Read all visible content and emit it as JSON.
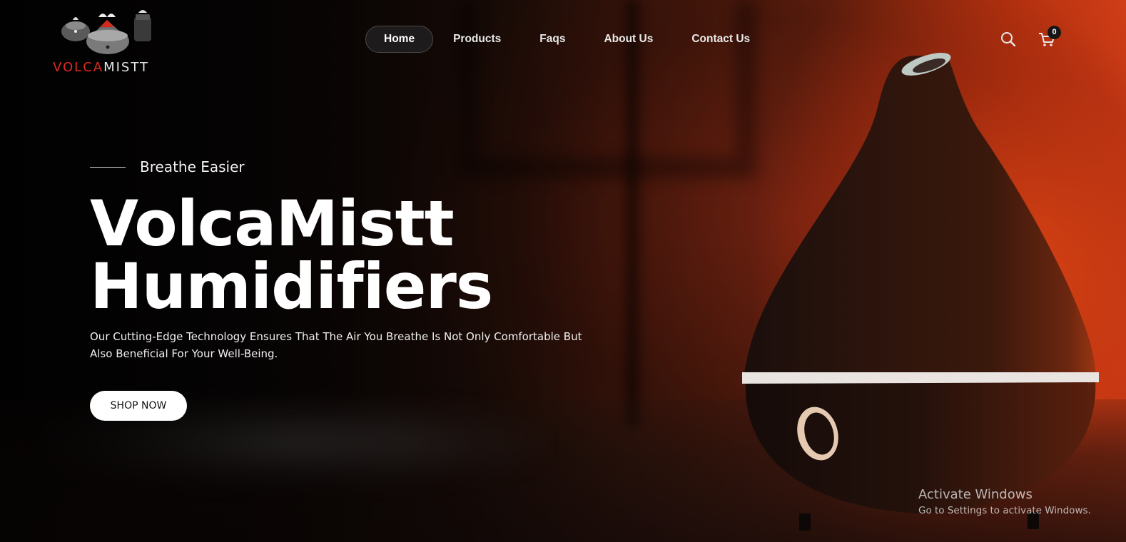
{
  "brand": {
    "name_part1": "VOLCA",
    "name_part2": "MISTT",
    "accent_color": "#e02a20"
  },
  "nav": {
    "items": [
      {
        "label": "Home",
        "active": true
      },
      {
        "label": "Products",
        "active": false
      },
      {
        "label": "Faqs",
        "active": false
      },
      {
        "label": "About Us",
        "active": false
      },
      {
        "label": "Contact Us",
        "active": false
      }
    ]
  },
  "header_icons": {
    "search_icon": "search-icon",
    "cart_icon": "cart-icon",
    "cart_count": "0"
  },
  "hero": {
    "tagline": "Breathe Easier",
    "title_line1": "VolcaMistt",
    "title_line2": "Humidifiers",
    "description": "Our Cutting-Edge Technology Ensures That The Air You Breathe Is Not Only Comfortable But Also Beneficial For Your Well-Being.",
    "cta_label": "SHOP NOW"
  },
  "os_watermark": {
    "title": "Activate Windows",
    "subtitle": "Go to Settings to activate Windows."
  }
}
